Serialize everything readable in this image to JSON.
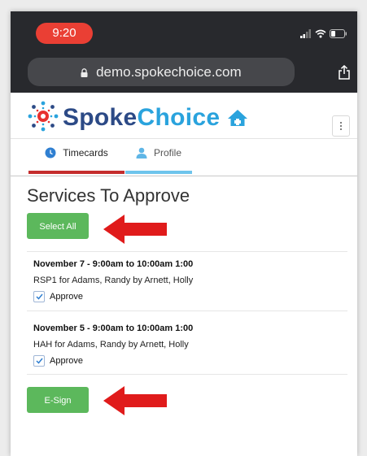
{
  "status_bar": {
    "time": "9:20"
  },
  "browser": {
    "url": "demo.spokechoice.com"
  },
  "header": {
    "logo_part1": "Spoke",
    "logo_part2": "Choice"
  },
  "tabs": [
    {
      "label": "Timecards",
      "active": true
    },
    {
      "label": "Profile",
      "active": false
    }
  ],
  "main": {
    "title": "Services To Approve",
    "select_all_label": "Select All",
    "esign_label": "E-Sign",
    "services": [
      {
        "title": "November 7 - 9:00am to 10:00am 1:00",
        "description": "RSP1 for Adams, Randy by Arnett, Holly",
        "approve_label": "Approve",
        "approved": true
      },
      {
        "title": "November 5 - 9:00am to 10:00am 1:00",
        "description": "HAH for Adams, Randy by Arnett, Holly",
        "approve_label": "Approve",
        "approved": true
      }
    ]
  },
  "colors": {
    "top_bar": "#28292d",
    "time_pill": "#ea3f34",
    "green_button": "#5cb85c",
    "active_tab_underline": "#c42d2d",
    "profile_tab_underline": "#6ec4ec",
    "annotation_arrow": "#e01b1b",
    "logo_dark": "#2c4a86",
    "logo_light": "#2aa3dd"
  }
}
